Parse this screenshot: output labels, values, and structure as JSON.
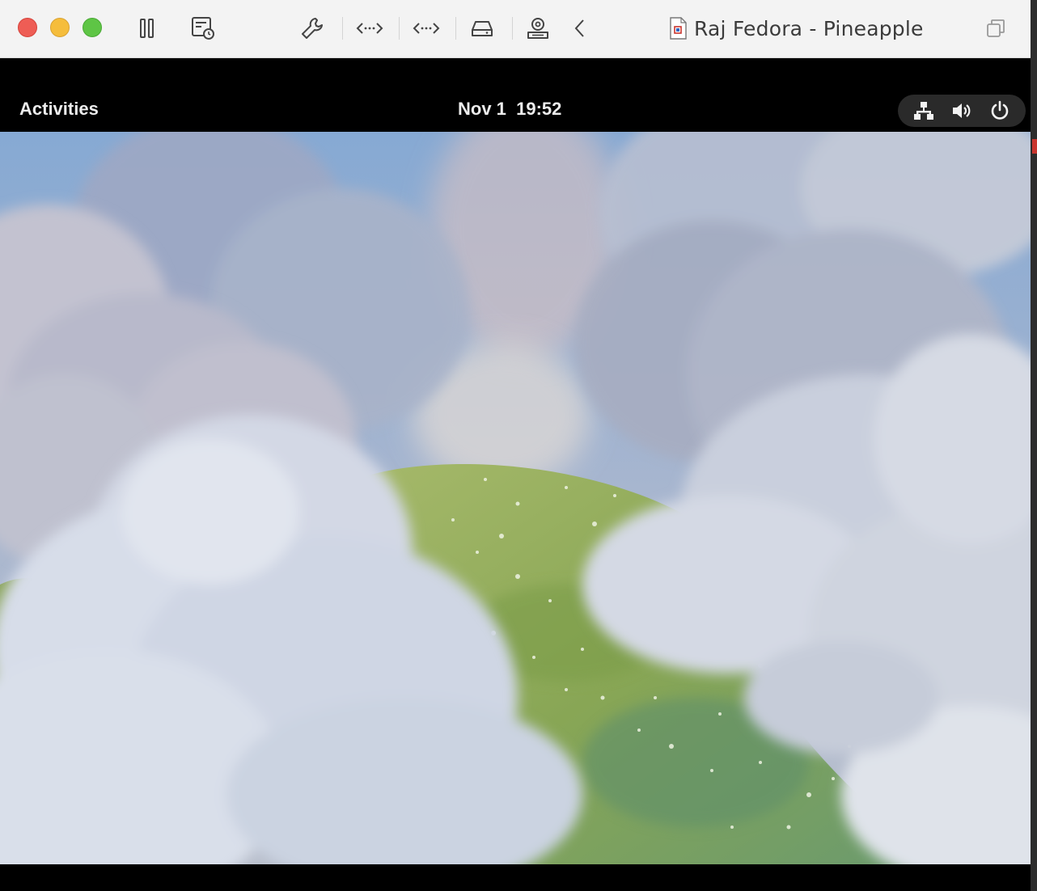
{
  "window": {
    "title": "Raj Fedora - Pineapple"
  },
  "toolbar": {
    "buttons": [
      {
        "icon": "pause-icon"
      },
      {
        "icon": "snapshot-icon"
      },
      {
        "icon": "wrench-icon"
      },
      {
        "icon": "code-arrows-icon"
      },
      {
        "icon": "code-arrows-icon"
      },
      {
        "icon": "hard-drive-icon"
      },
      {
        "icon": "user-device-icon"
      },
      {
        "icon": "chevron-left-icon"
      }
    ]
  },
  "gnome": {
    "activities": "Activities",
    "clock": "Nov 1  19:52",
    "tray": [
      {
        "icon": "network-icon"
      },
      {
        "icon": "volume-icon"
      },
      {
        "icon": "power-icon"
      }
    ]
  },
  "colors": {
    "close": "#ee5d55",
    "minimize": "#f5bd3c",
    "zoom": "#5ec545",
    "gnome_bar": "#000000",
    "sky": "#8fb0d6",
    "meadow": "#8fa85a"
  }
}
